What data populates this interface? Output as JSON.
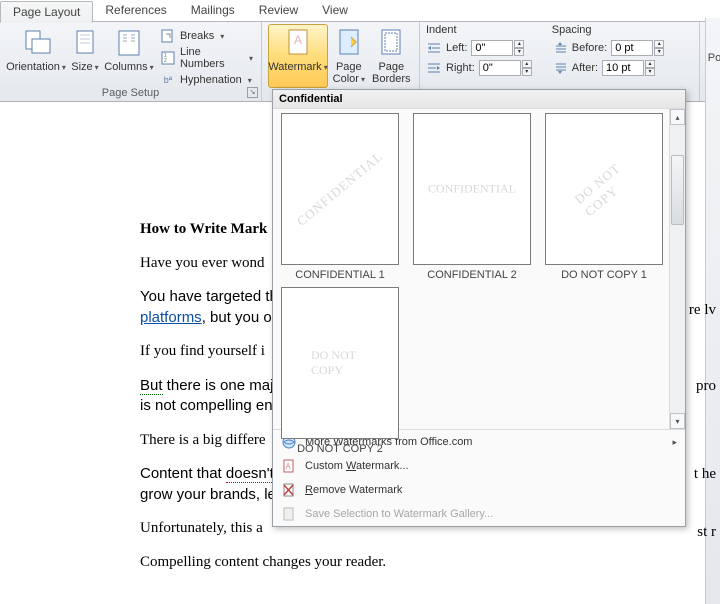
{
  "tabs": {
    "page_layout": "Page Layout",
    "references": "References",
    "mailings": "Mailings",
    "review": "Review",
    "view": "View"
  },
  "ribbon": {
    "page_setup": {
      "title": "Page Setup",
      "orientation": "Orientation",
      "size": "Size",
      "columns": "Columns",
      "breaks": "Breaks",
      "line_numbers": "Line Numbers",
      "hyphenation": "Hyphenation"
    },
    "page_background": {
      "watermark": "Watermark",
      "page_color": "Page Color",
      "page_borders": "Page Borders"
    },
    "paragraph": {
      "indent_title": "Indent",
      "spacing_title": "Spacing",
      "left": "Left:",
      "right": "Right:",
      "before": "Before:",
      "after": "After:",
      "left_val": "0\"",
      "right_val": "0\"",
      "before_val": "0 pt",
      "after_val": "10 pt"
    },
    "pos_cut": "Po"
  },
  "gallery": {
    "header": "Confidential",
    "items": [
      {
        "text": "CONFIDENTIAL",
        "style": "diag",
        "caption": "CONFIDENTIAL 1"
      },
      {
        "text": "CONFIDENTIAL",
        "style": "horiz",
        "caption": "CONFIDENTIAL 2"
      },
      {
        "text": "DO NOT COPY",
        "style": "diag",
        "caption": "DO NOT COPY 1"
      },
      {
        "text": "DO NOT COPY",
        "style": "horiz",
        "caption": "DO NOT COPY 2"
      }
    ],
    "menu": {
      "more": "More Watermarks from Office.com",
      "custom": "Custom Watermark...",
      "remove": "Remove Watermark",
      "save": "Save Selection to Watermark Gallery..."
    },
    "accel": {
      "custom": "W",
      "remove": "R"
    }
  },
  "document": {
    "heading_vis": "How to Write Mark",
    "p1_vis": "Have you ever wond",
    "p2a_vis": "You have targeted th",
    "p2b_link": "platforms",
    "p2b_rest": ", but you o",
    "p3_vis": "If you find yourself i",
    "p4a": "But",
    "p4b": " there is one major ",
    "p4c": "is not compelling en",
    "p5_vis": "There is a big differe",
    "p6a": "Content that ",
    "p6b": "doesn't",
    "p6c": "grow your brands, le",
    "p7_vis": "Unfortunately, this a",
    "p8": "Compelling content changes your reader.",
    "frag_lv": "re lv",
    "frag_pro": "pro",
    "frag_the": "t he",
    "frag_str": "st r"
  }
}
